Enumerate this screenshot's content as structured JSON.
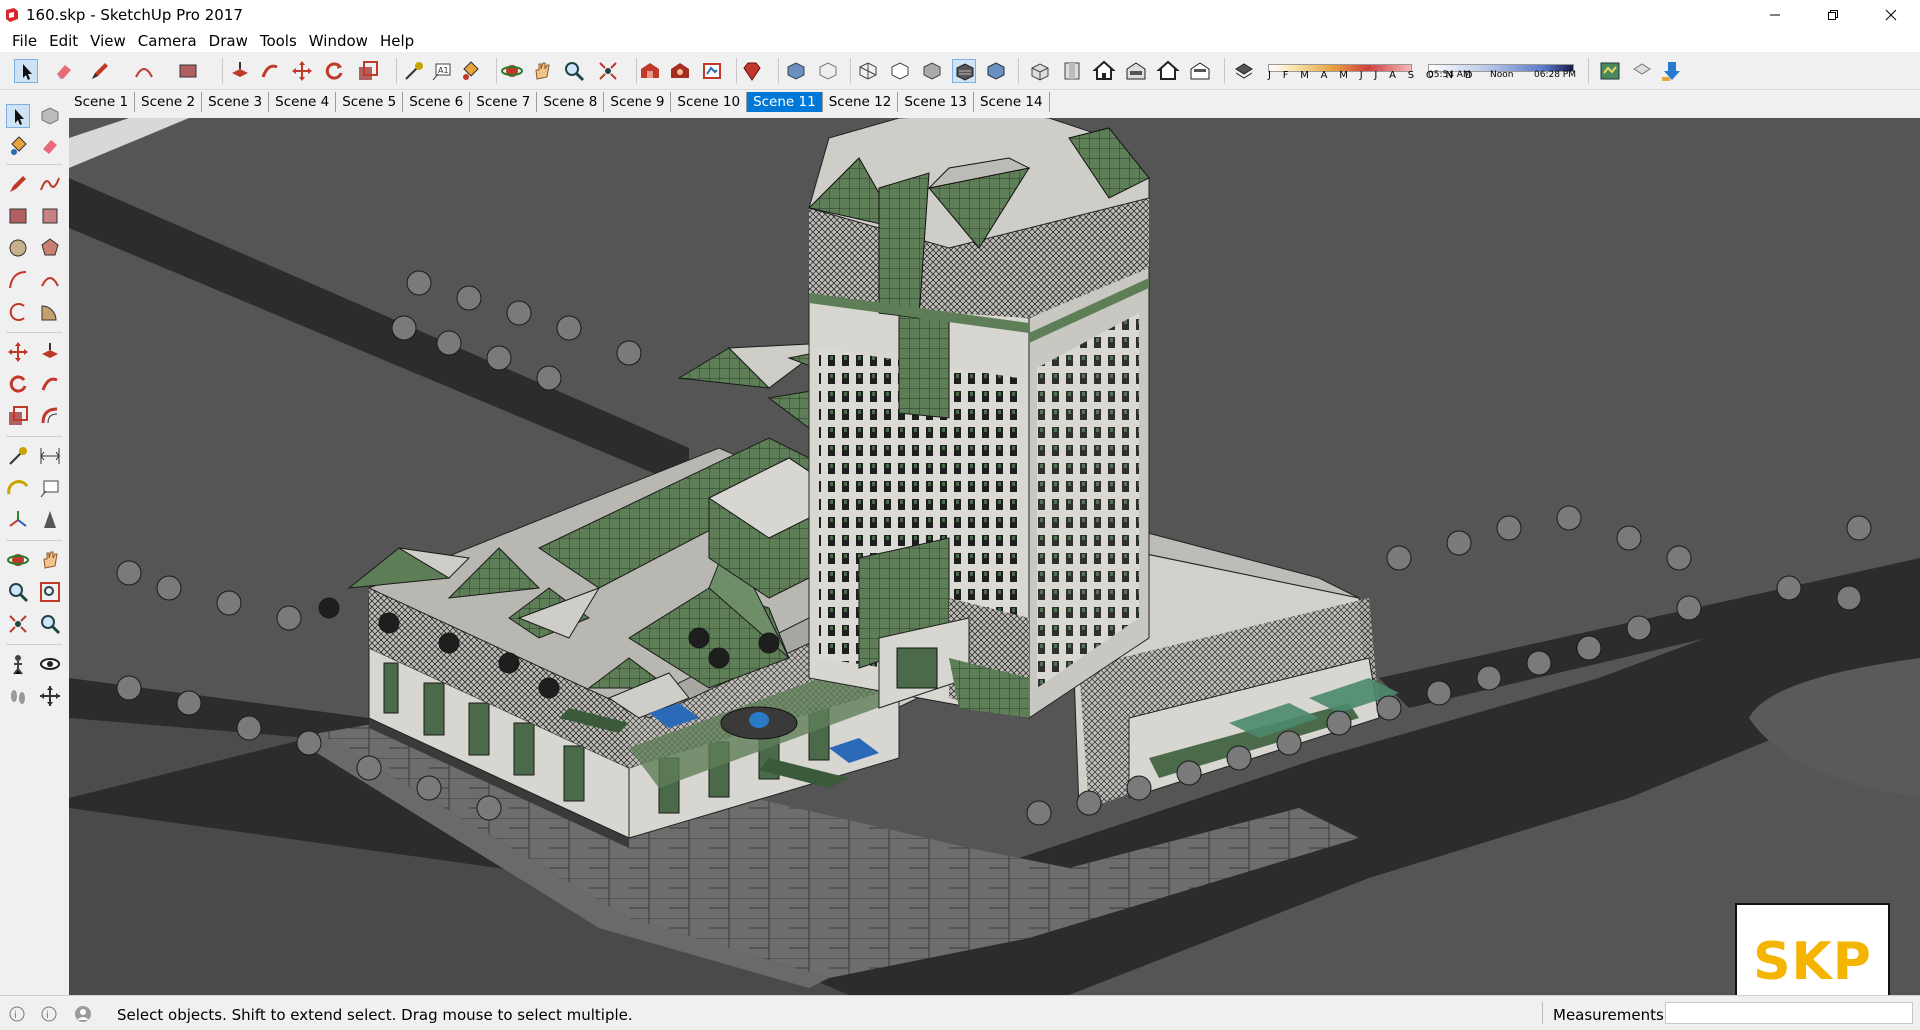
{
  "window": {
    "title": "160.skp - SketchUp Pro 2017",
    "controls": [
      "minimize-icon",
      "restore-icon",
      "close-icon"
    ]
  },
  "menu": [
    "File",
    "Edit",
    "View",
    "Camera",
    "Draw",
    "Tools",
    "Window",
    "Help"
  ],
  "toolbar": {
    "icons": [
      "select-icon",
      "eraser-icon",
      "pencil-icon",
      "arc-icon",
      "rectangle-icon",
      "push-pull-icon",
      "follow-me-icon",
      "move-icon",
      "rotate-icon",
      "scale-icon",
      "tape-measure-icon",
      "text-icon",
      "paint-bucket-icon",
      "orbit-icon",
      "pan-icon",
      "zoom-icon",
      "zoom-extents-icon",
      "warehouse-icon",
      "extension-warehouse-icon",
      "layout-icon",
      "ruby-icon",
      "xray-icon",
      "back-edges-icon",
      "wireframe-icon",
      "hidden-line-icon",
      "shaded-icon",
      "shaded-texture-icon",
      "monochrome-icon",
      "iso-view-icon",
      "top-view-icon",
      "front-view-icon",
      "right-view-icon",
      "back-view-icon",
      "left-view-icon",
      "shadows-icon",
      "geo-location-icon",
      "add-location-icon",
      "photo-texture-icon"
    ],
    "shadow_months": "J F M A M J J A S O N D",
    "shadow_time_start": "05:54 AM",
    "shadow_time_mid": "Noon",
    "shadow_time_end": "06:28 PM"
  },
  "scenes": {
    "tabs": [
      "Scene 1",
      "Scene 2",
      "Scene 3",
      "Scene 4",
      "Scene 5",
      "Scene 6",
      "Scene 7",
      "Scene 8",
      "Scene 9",
      "Scene 10",
      "Scene 11",
      "Scene 12",
      "Scene 13",
      "Scene 14"
    ],
    "active": "Scene 11"
  },
  "left_tools": [
    "select-icon",
    "make-component-icon",
    "paint-bucket-icon",
    "eraser-icon",
    "line-icon",
    "freehand-icon",
    "rectangle-icon",
    "rotated-rectangle-icon",
    "circle-icon",
    "polygon-icon",
    "arc-icon",
    "two-point-arc-icon",
    "three-point-arc-icon",
    "pie-icon",
    "move-icon",
    "push-pull-icon",
    "rotate-icon",
    "follow-me-icon",
    "scale-icon",
    "offset-icon",
    "tape-measure-icon",
    "dimension-icon",
    "protractor-icon",
    "text-icon",
    "axes-icon",
    "3d-text-icon",
    "orbit-icon",
    "pan-icon",
    "zoom-icon",
    "zoom-window-icon",
    "zoom-extents-icon",
    "previous-view-icon",
    "position-camera-icon",
    "look-around-icon",
    "walk-icon",
    "section-plane-icon"
  ],
  "viewport": {
    "watermark": "SKP",
    "colors": {
      "ground": "#555555",
      "road": "#2c2c2c",
      "building_wall": "#d8d6d0",
      "glass": "#5a7a55",
      "paving": "#7a7a7a"
    }
  },
  "status": {
    "message": "Select objects. Shift to extend select. Drag mouse to select multiple.",
    "measurements_label": "Measurements",
    "measurements_value": ""
  },
  "colors": {
    "accent": "#0078d7",
    "logo_yellow": "#f5b400"
  }
}
